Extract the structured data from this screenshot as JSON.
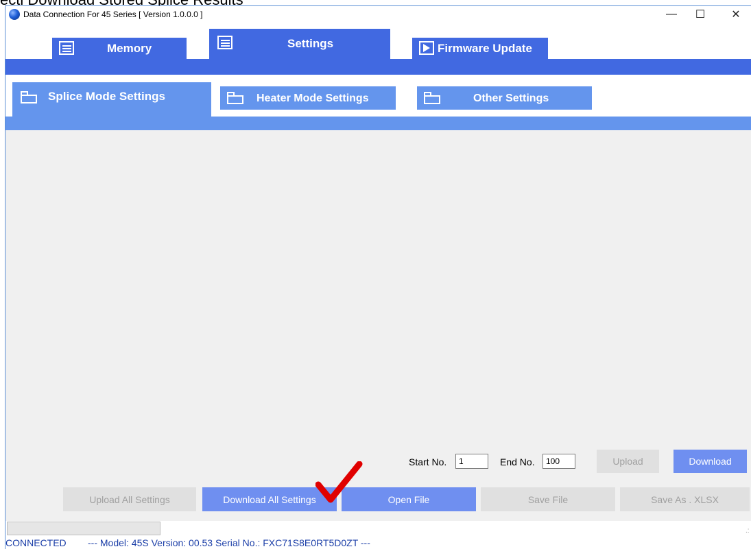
{
  "window": {
    "title": "Data Connection For 45 Series [ Version 1.0.0.0 ]",
    "top_caption": "ecti Download Stored Splice Results",
    "controls": {
      "minimize": "—",
      "maximize": "☐",
      "close": "✕"
    }
  },
  "main_tabs": [
    {
      "label": "Memory",
      "icon": "list-icon",
      "active": false
    },
    {
      "label": "Settings",
      "icon": "list-icon",
      "active": true
    },
    {
      "label": "Firmware Update",
      "icon": "play-icon",
      "active": false
    }
  ],
  "sub_tabs": [
    {
      "label": "Splice Mode Settings",
      "icon": "folder-icon",
      "active": true
    },
    {
      "label": "Heater Mode Settings",
      "icon": "folder-icon",
      "active": false
    },
    {
      "label": "Other Settings",
      "icon": "folder-icon",
      "active": false
    }
  ],
  "range": {
    "start_label": "Start No.",
    "start_value": "1",
    "end_label": "End No.",
    "end_value": "100"
  },
  "buttons": {
    "upload": {
      "label": "Upload",
      "enabled": false
    },
    "download": {
      "label": "Download",
      "enabled": true
    },
    "upload_all": {
      "label": "Upload All Settings",
      "enabled": false
    },
    "download_all": {
      "label": "Download All Settings",
      "enabled": true
    },
    "open_file": {
      "label": "Open File",
      "enabled": true
    },
    "save_file": {
      "label": "Save File",
      "enabled": false
    },
    "save_xlsx": {
      "label": "Save As . XLSX",
      "enabled": false
    }
  },
  "status": {
    "connection": "CONNECTED",
    "details": "---  Model: 45S  Version: 00.53  Serial No.: FXC71S8E0RT5D0ZT  ---"
  },
  "colors": {
    "tab_blue": "#4169e1",
    "sub_tab_blue": "#6495ed",
    "button_enabled": "#6f8ff0",
    "check_mark": "#e00000"
  }
}
